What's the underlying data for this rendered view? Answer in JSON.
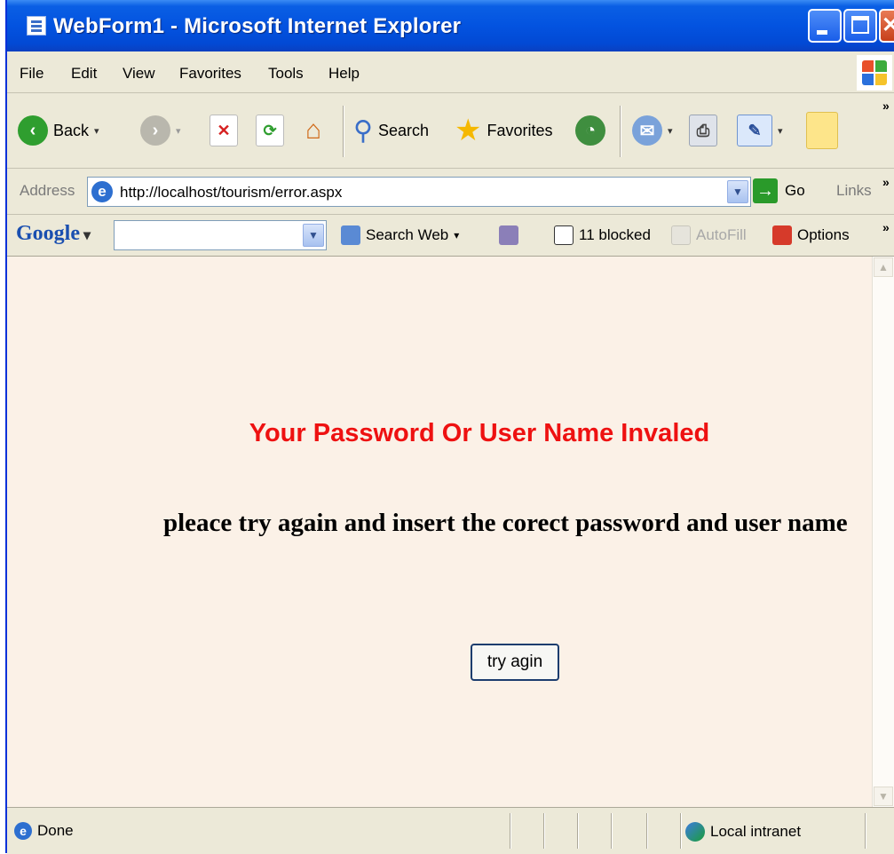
{
  "window": {
    "title": "WebForm1 - Microsoft Internet Explorer"
  },
  "menu": [
    "File",
    "Edit",
    "View",
    "Favorites",
    "Tools",
    "Help"
  ],
  "toolbar": {
    "back_label": "Back",
    "search_label": "Search",
    "favorites_label": "Favorites"
  },
  "address": {
    "label": "Address",
    "url": "http://localhost/tourism/error.aspx",
    "go_label": "Go",
    "links_label": "Links"
  },
  "google": {
    "logo": "Google",
    "search_value": "",
    "search_web_label": "Search Web",
    "blocked_label": "11 blocked",
    "autofill_label": "AutoFill",
    "options_label": "Options"
  },
  "page": {
    "error_title": "Your Password Or User Name Invaled",
    "error_message": "pleace try again and insert the corect password and user name",
    "retry_button": "try agin"
  },
  "status": {
    "text": "Done",
    "zone": "Local intranet"
  },
  "colors": {
    "error_red": "#ee1111",
    "page_background": "#fbf1e7",
    "titlebar_blue": "#0353e0"
  }
}
